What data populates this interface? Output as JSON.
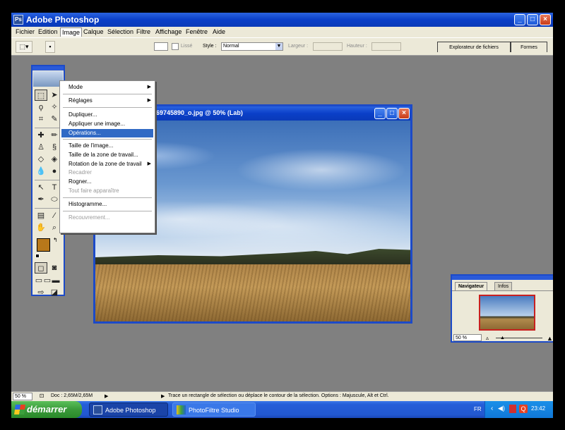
{
  "app": {
    "title": "Adobe Photoshop",
    "icon": "photoshop-icon"
  },
  "window_controls": {
    "minimize": "_",
    "maximize": "□",
    "close": "×"
  },
  "menubar": [
    "Fichier",
    "Edition",
    "Image",
    "Calque",
    "Sélection",
    "Filtre",
    "Affichage",
    "Fenêtre",
    "Aide"
  ],
  "options": {
    "lisse_label": "Lissé",
    "style_label": "Style :",
    "style_value": "Normal",
    "largeur_label": "Largeur :",
    "hauteur_label": "Hauteur :",
    "explorer_tab": "Explorateur de fichiers",
    "formes_tab": "Formes"
  },
  "image_menu": {
    "mode": "Mode",
    "reglages": "Réglages",
    "dupliquer": "Dupliquer...",
    "appliquer": "Appliquer une image...",
    "operations": "Opérations...",
    "taille_image": "Taille de l'image...",
    "taille_zone": "Taille de la zone de travail...",
    "rotation": "Rotation de la zone de travail",
    "recadrer": "Recadrer",
    "rogner": "Rogner...",
    "tout_faire": "Tout faire apparaître",
    "histogramme": "Histogramme...",
    "recouvrement": "Recouvrement...",
    "submenu_arrow": "▶"
  },
  "document": {
    "title": "69745890_o.jpg @ 50% (Lab)"
  },
  "navigator": {
    "tab_navigator": "Navigateur",
    "tab_infos": "Infos",
    "zoom": "50 %"
  },
  "status": {
    "zoom": "50 %",
    "doc": "Doc : 2,65M/2,65M",
    "hint": "Trace un rectangle de sélection ou déplace le contour de la sélection. Options : Majuscule, Alt et Ctrl."
  },
  "taskbar": {
    "start": "démarrer",
    "tasks": [
      "Adobe Photoshop",
      "PhotoFiltre Studio"
    ],
    "lang": "FR",
    "clock": "23:42"
  },
  "colors": {
    "foreground": "#b8781a",
    "background": "#ffffff",
    "accent": "#1c4ac8"
  }
}
